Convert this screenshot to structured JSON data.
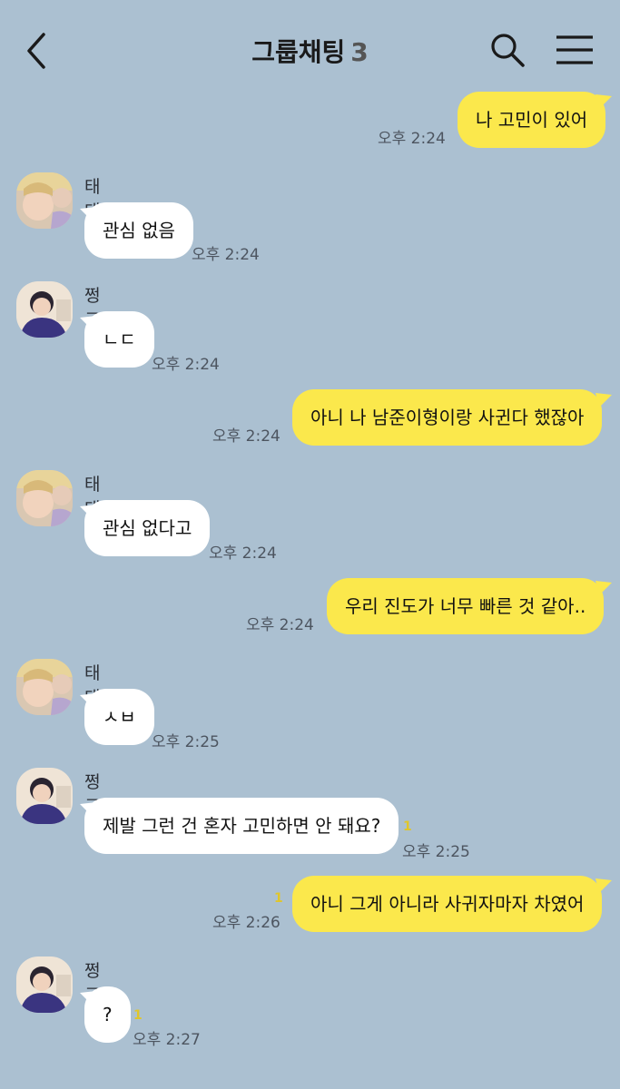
{
  "header": {
    "title": "그룹채팅",
    "member_count": "3"
  },
  "colors": {
    "background": "#abc0d1",
    "my_bubble": "#fbe84c",
    "their_bubble": "#ffffff",
    "unread_count": "#e0c62a"
  },
  "messages": [
    {
      "from": "me",
      "text": "나 고민이 있어",
      "time": "오후 2:24",
      "unread": ""
    },
    {
      "from": "태태",
      "text": "관심 없음",
      "time": "오후 2:24",
      "unread": ""
    },
    {
      "from": "쩡구기",
      "text": "ㄴㄷ",
      "time": "오후 2:24",
      "unread": ""
    },
    {
      "from": "me",
      "text": "아니 나 남준이형이랑 사귄다 했잖아",
      "time": "오후 2:24",
      "unread": ""
    },
    {
      "from": "태태",
      "text": "관심 없다고",
      "time": "오후 2:24",
      "unread": ""
    },
    {
      "from": "me",
      "text": "우리 진도가 너무 빠른 것 같아..",
      "time": "오후 2:24",
      "unread": ""
    },
    {
      "from": "태태",
      "text": "ㅅㅂ",
      "time": "오후 2:25",
      "unread": ""
    },
    {
      "from": "쩡구기",
      "text": "제발 그런 건 혼자 고민하면 안 돼요?",
      "time": "오후 2:25",
      "unread": "1"
    },
    {
      "from": "me",
      "text": "아니 그게 아니라 사귀자마자 차였어",
      "time": "오후 2:26",
      "unread": "1"
    },
    {
      "from": "쩡구기",
      "text": "?",
      "time": "오후 2:27",
      "unread": "1"
    }
  ]
}
